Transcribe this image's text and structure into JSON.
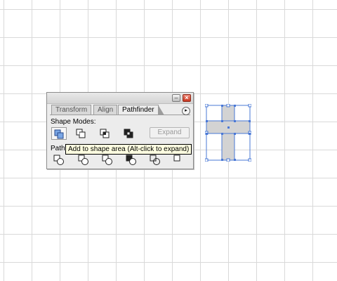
{
  "panel": {
    "tabs": [
      "Transform",
      "Align",
      "Pathfinder"
    ],
    "active_tab": "Pathfinder",
    "shape_modes_label": "Shape Modes:",
    "shape_mode_buttons": [
      "add-to-shape-area",
      "subtract-from-shape-area",
      "intersect-shape-areas",
      "exclude-overlapping-shape-areas"
    ],
    "expand_label": "Expand",
    "pathfinders_label": "Pathfinders:",
    "pathfinder_buttons": [
      "divide",
      "trim",
      "merge",
      "crop",
      "outline",
      "minus-back"
    ]
  },
  "tooltip": {
    "text": "Add to shape area (Alt-click to expand)"
  },
  "colors": {
    "selection": "#4a78d6",
    "shape_fill": "#d3d3d3",
    "grid": "#d9d9d9",
    "panel_bg": "#ececec",
    "close_red": "#d9432b"
  }
}
